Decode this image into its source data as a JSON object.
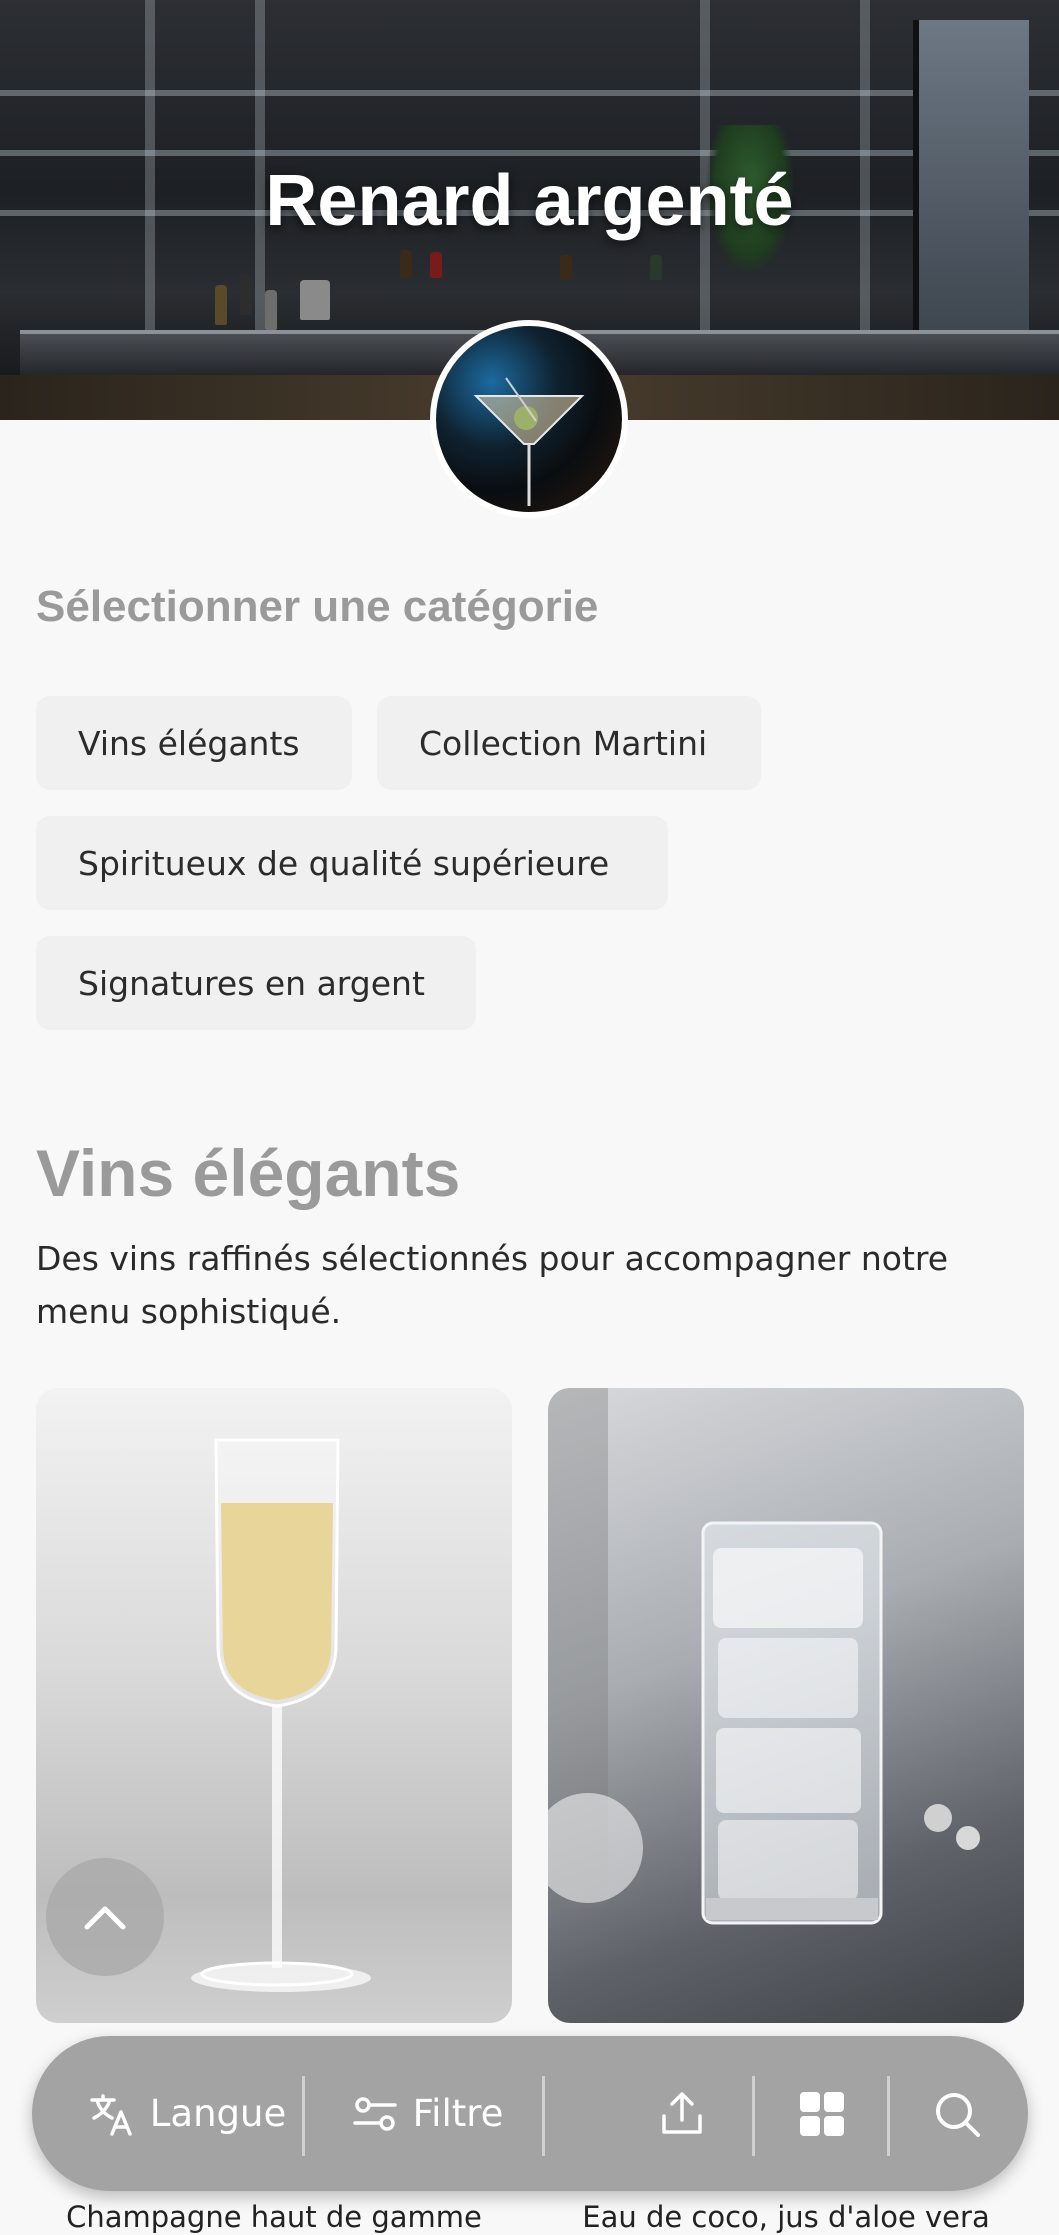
{
  "restaurant": {
    "name": "Renard argenté"
  },
  "categories": {
    "heading": "Sélectionner une catégorie",
    "items": [
      {
        "label": "Vins élégants"
      },
      {
        "label": "Collection Martini"
      },
      {
        "label": "Spiritueux de qualité supérieure"
      },
      {
        "label": "Signatures en argent"
      }
    ]
  },
  "section": {
    "title": "Vins élégants",
    "description": "Des vins raffinés sélectionnés pour accompagner notre menu sophistiqué."
  },
  "products": [
    {
      "name": "Champagne haut de gamme"
    },
    {
      "name": "Eau de coco, jus d'aloe vera"
    }
  ],
  "bottom_bar": {
    "language_label": "Langue",
    "filter_label": "Filtre"
  },
  "icons": {
    "scroll_top": "chevron-up-icon",
    "language": "translate-icon",
    "filter": "sliders-icon",
    "share": "share-icon",
    "grid": "grid-icon",
    "search": "search-icon"
  },
  "colors": {
    "bar_background": "#a3a3a3",
    "heading_grey": "#9a9a9a",
    "chip_background": "#f0f0f0"
  }
}
